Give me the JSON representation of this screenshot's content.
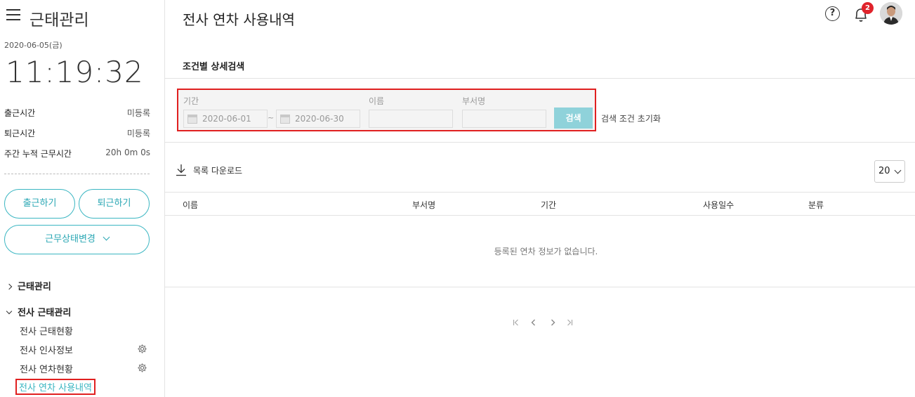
{
  "sidebar": {
    "app_title": "근태관리",
    "date": "2020-06-05(금)",
    "time": "11:19:32",
    "stats": [
      {
        "label": "출근시간",
        "value": "미등록"
      },
      {
        "label": "퇴근시간",
        "value": "미등록"
      },
      {
        "label": "주간 누적 근무시간",
        "value": "20h 0m 0s"
      }
    ],
    "btn_checkin": "출근하기",
    "btn_checkout": "퇴근하기",
    "btn_status": "근무상태변경",
    "group1": "근태관리",
    "group2": "전사 근태관리",
    "items": [
      {
        "label": "전사 근태현황"
      },
      {
        "label": "전사 인사정보"
      },
      {
        "label": "전사 연차현황"
      },
      {
        "label": "전사 연차 사용내역"
      }
    ]
  },
  "header": {
    "title": "전사 연차 사용내역",
    "help": "?",
    "notification_count": "2"
  },
  "filter": {
    "section_title": "조건별 상세검색",
    "period_label": "기간",
    "start_date": "2020-06-01",
    "separator": "~",
    "end_date": "2020-06-30",
    "name_label": "이름",
    "name_value": "",
    "dept_label": "부서명",
    "dept_value": "",
    "search_button": "검색",
    "reset_link": "검색 조건 초기화"
  },
  "list": {
    "download_label": "목록 다운로드",
    "page_size": "20",
    "columns": [
      "이름",
      "부서명",
      "기간",
      "사용일수",
      "분류"
    ],
    "empty_message": "등록된 연차 정보가 없습니다."
  },
  "icons": {
    "menu": "hamburger-icon",
    "help": "help-icon",
    "bell": "bell-icon",
    "gear": "gear-icon",
    "download": "download-icon",
    "calendar": "calendar-icon"
  },
  "colors": {
    "accent": "#3bb6c2",
    "badge": "#e0232b",
    "highlight_border": "#e02020",
    "search_button": "#8fd2da"
  }
}
